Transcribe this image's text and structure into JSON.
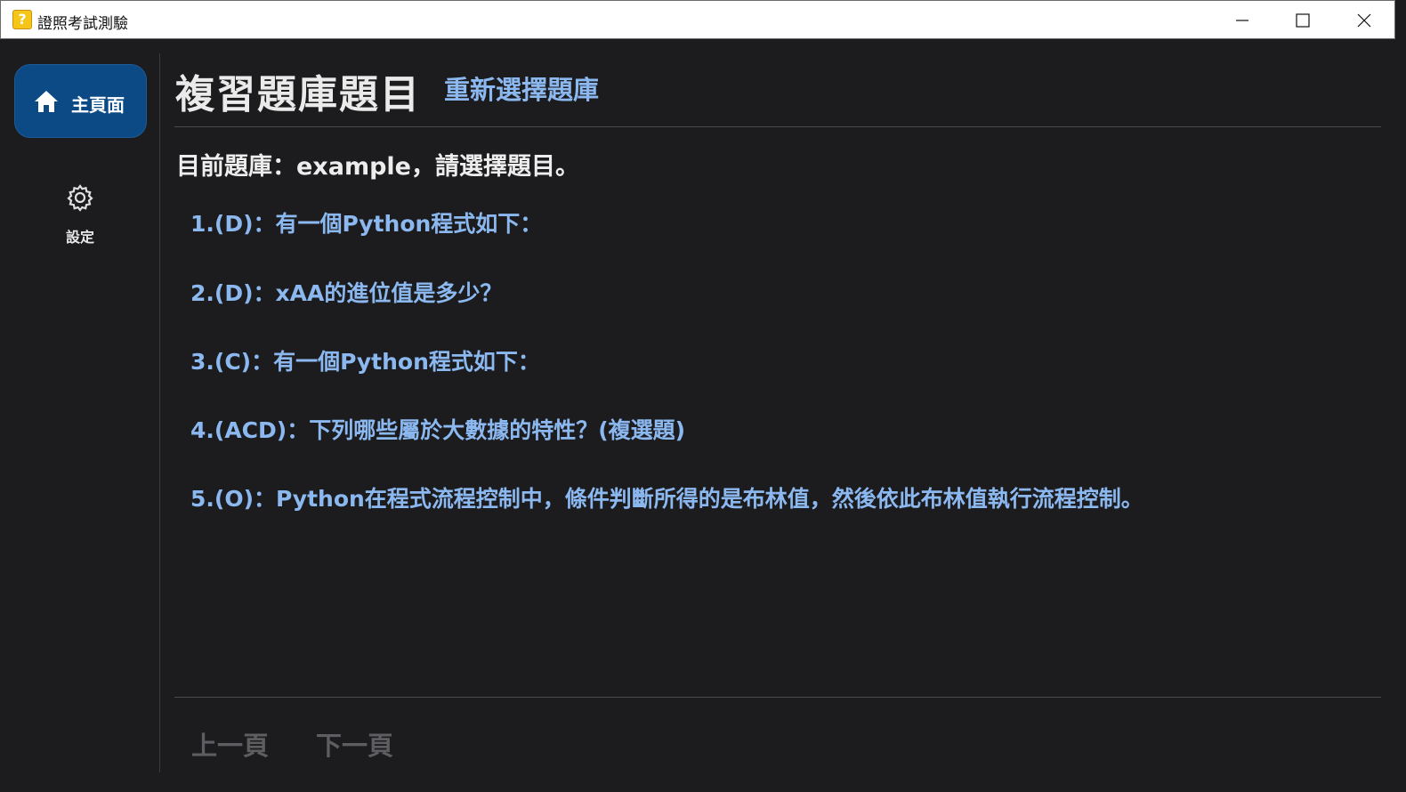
{
  "window": {
    "title": "證照考試測驗",
    "app_icon_glyph": "?",
    "controls": [
      "minimize-icon",
      "maximize-icon",
      "close-icon"
    ]
  },
  "sidebar": {
    "home_label": "主頁面",
    "home_icon": "home-icon",
    "settings_label": "設定",
    "settings_icon": "gear-icon"
  },
  "header": {
    "title": "複習題庫題目",
    "reselect_link": "重新選擇題庫"
  },
  "bank_label": "目前題庫：example，請選擇題目。",
  "questions": [
    "1.(D)：有一個Python程式如下：",
    "2.(D)：xAA的進位值是多少？",
    "3.(C)：有一個Python程式如下：",
    "4.(ACD)：下列哪些屬於大數據的特性？(複選題)",
    "5.(O)：Python在程式流程控制中，條件判斷所得的是布林值，然後依此布林值執行流程控制。"
  ],
  "pager": {
    "prev": "上一頁",
    "next": "下一頁"
  },
  "colors": {
    "background": "#1c1c1f",
    "accent_link": "#8cb8f0",
    "home_button": "#0c4a86",
    "disabled_text": "#5e5e62"
  }
}
